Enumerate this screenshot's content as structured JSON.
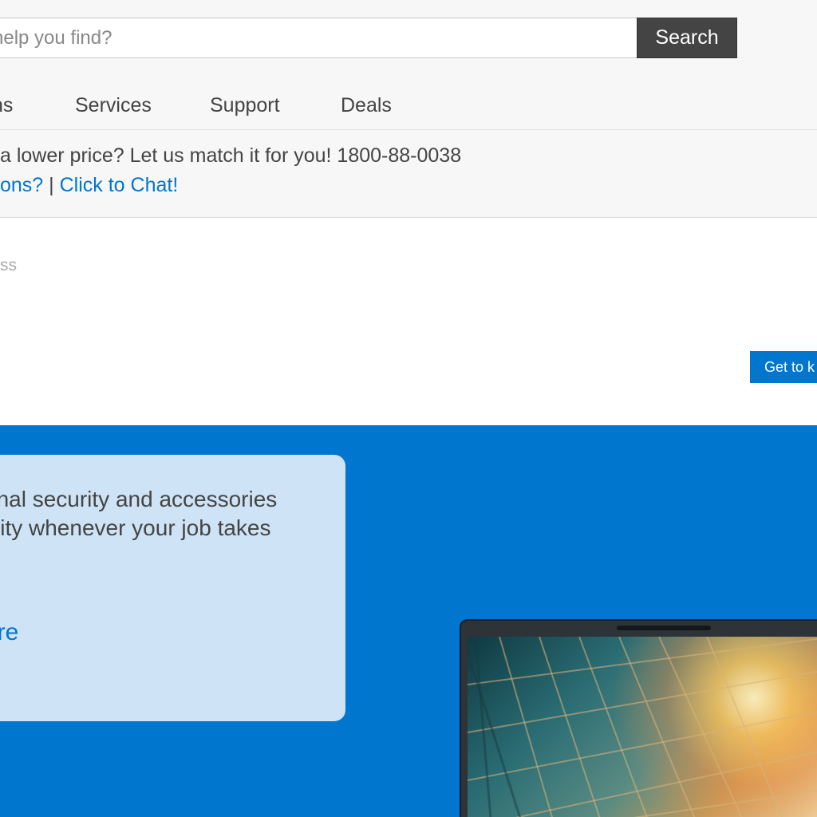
{
  "search": {
    "placeholder": "help you find?",
    "button_label": "Search"
  },
  "nav": {
    "items": [
      {
        "label": "ns"
      },
      {
        "label": "Services"
      },
      {
        "label": "Support"
      },
      {
        "label": "Deals"
      }
    ]
  },
  "promo": {
    "line1": "a lower price? Let us match it for you! 1800-88-0038",
    "questions_link": "ons?",
    "separator": " | ",
    "chat_link": "Click to Chat!"
  },
  "breadcrumb": {
    "text": "ss"
  },
  "cta": {
    "label": "Get to k"
  },
  "banner": {
    "card_line1": "onal security and accessories",
    "card_line2": "ivity whenever your job takes",
    "card_link": "ere"
  },
  "colors": {
    "accent": "#0076ce",
    "search_button": "#444444",
    "card_background": "#cfe3f6",
    "page_background": "#f7f7f7"
  },
  "icons": {
    "laptop": "laptop-image"
  }
}
